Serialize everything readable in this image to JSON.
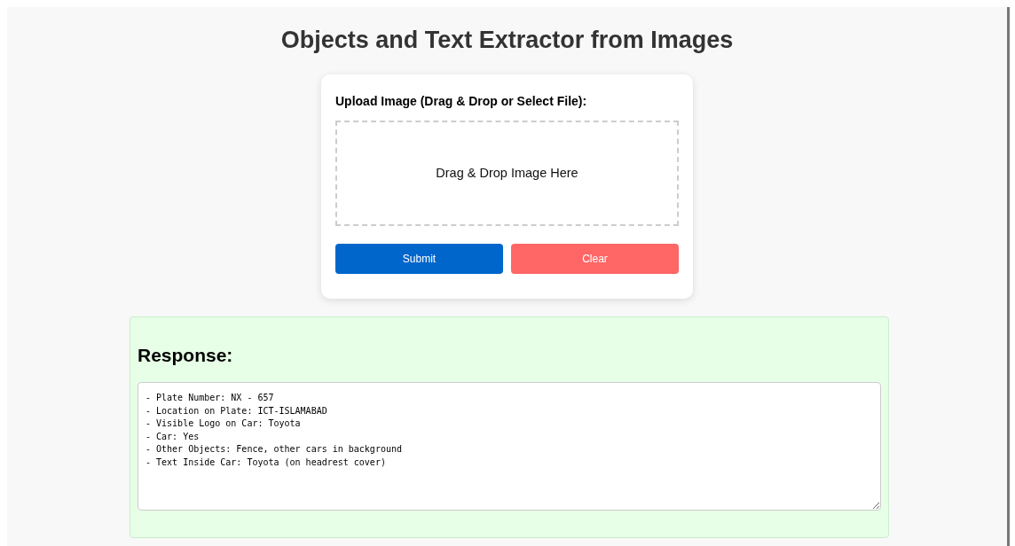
{
  "title": "Objects and Text Extractor from Images",
  "upload": {
    "label": "Upload Image (Drag & Drop or Select File):",
    "drop_zone": "Drag & Drop Image Here"
  },
  "buttons": [
    {
      "label": "Submit",
      "kind": "primary"
    },
    {
      "label": "Clear",
      "kind": "danger"
    }
  ],
  "response": {
    "heading": "Response:",
    "lines": [
      "- Plate Number: NX - 657",
      "- Location on Plate: ICT-ISLAMABAD",
      "- Visible Logo on Car: Toyota",
      "- Car: Yes",
      "- Other Objects: Fence, other cars in background",
      "- Text Inside Car: Toyota (on headrest cover)"
    ]
  }
}
